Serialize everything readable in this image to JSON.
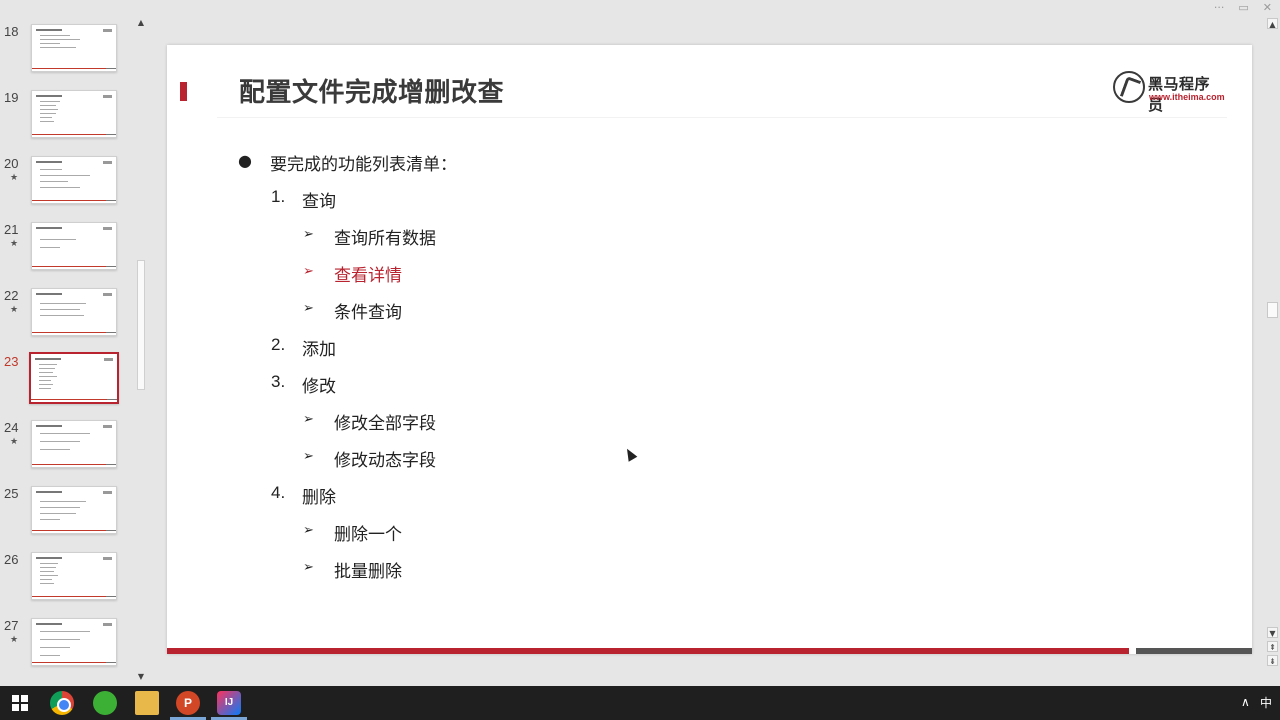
{
  "window_controls": [
    "···",
    "▭",
    "✕"
  ],
  "thumbnails": [
    {
      "number": "18",
      "star": false,
      "active": false
    },
    {
      "number": "19",
      "star": false,
      "active": false
    },
    {
      "number": "20",
      "star": true,
      "active": false
    },
    {
      "number": "21",
      "star": true,
      "active": false
    },
    {
      "number": "22",
      "star": true,
      "active": false
    },
    {
      "number": "23",
      "star": false,
      "active": true
    },
    {
      "number": "24",
      "star": true,
      "active": false
    },
    {
      "number": "25",
      "star": false,
      "active": false
    },
    {
      "number": "26",
      "star": false,
      "active": false
    },
    {
      "number": "27",
      "star": true,
      "active": false
    }
  ],
  "star_glyph": "★",
  "slide": {
    "title": "配置文件完成增删改查",
    "logo": {
      "name": "黑马程序员",
      "url": "www.itheima.com"
    },
    "bullet_dot": "●",
    "intro": "要完成的功能列表清单：",
    "items": [
      {
        "num": "1.",
        "label": "查询",
        "subs": [
          {
            "label": "查询所有数据",
            "highlight": false
          },
          {
            "label": "查看详情",
            "highlight": true
          },
          {
            "label": "条件查询",
            "highlight": false
          }
        ]
      },
      {
        "num": "2.",
        "label": "添加",
        "subs": []
      },
      {
        "num": "3.",
        "label": "修改",
        "subs": [
          {
            "label": "修改全部字段",
            "highlight": false
          },
          {
            "label": "修改动态字段",
            "highlight": false
          }
        ]
      },
      {
        "num": "4.",
        "label": "删除",
        "subs": [
          {
            "label": "删除一个",
            "highlight": false
          },
          {
            "label": "批量删除",
            "highlight": false
          }
        ]
      }
    ],
    "arrow_glyph": "➢"
  },
  "colors": {
    "accent": "#b8232f",
    "taskbar": "#1f1f1f"
  },
  "taskbar": {
    "apps": [
      "windows-start",
      "chrome",
      "wechat",
      "file-explorer",
      "powerpoint",
      "intellij-idea"
    ],
    "ppt_label": "P",
    "idea_label": "IJ",
    "tray_chevron": "∧",
    "ime_label": "中"
  }
}
